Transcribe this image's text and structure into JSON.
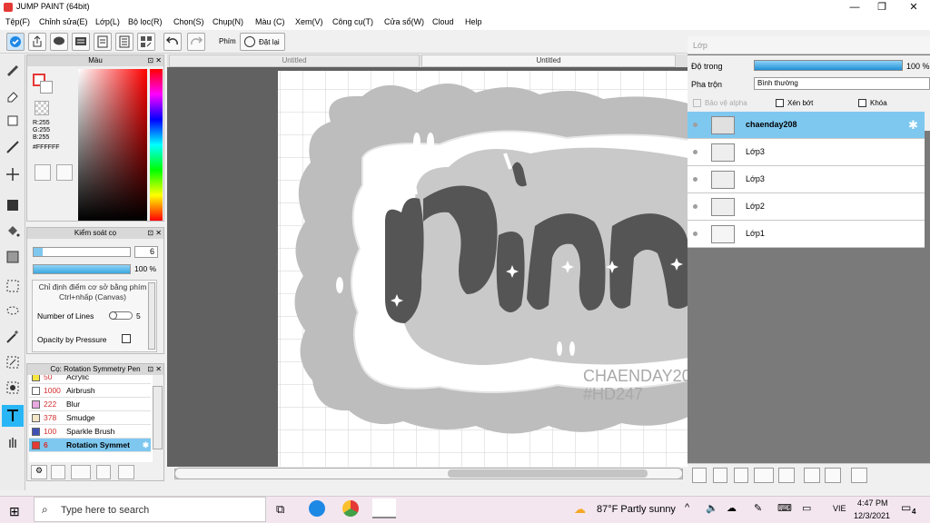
{
  "window": {
    "title": "JUMP PAINT (64bit)"
  },
  "menu": [
    "Tệp(F)",
    "Chỉnh sửa(E)",
    "Lớp(L)",
    "Bộ lọc(R)",
    "Chọn(S)",
    "Chụp(N)",
    "Màu (C)",
    "Xem(V)",
    "Công cụ(T)",
    "Cửa sổ(W)",
    "Cloud",
    "Help"
  ],
  "toolbar": {
    "label_phim": "Phím",
    "reset_label": "Đặt lại"
  },
  "color_panel": {
    "title": "Màu",
    "r": "R:255",
    "g": "G:255",
    "b": "B:255",
    "hex": "#FFFFFF"
  },
  "brush_control": {
    "title": "Kiểm soát cọ",
    "size_value": "6",
    "opacity_value": "100 %",
    "opacity_fraction": 1.0,
    "hint": "Chỉ định điểm cơ sở bằng phím Ctrl+nhấp (Canvas)",
    "lines_label": "Number of Lines",
    "lines_value": "5",
    "pressure_label": "Opacity by Pressure"
  },
  "brush_list": {
    "title": "Cọ: Rotation Symmetry Pen",
    "items": [
      {
        "size": "50",
        "name": "Acrylic",
        "swatch": "#f5e642"
      },
      {
        "size": "1000",
        "name": "Airbrush",
        "swatch": "#ffffff"
      },
      {
        "size": "222",
        "name": "Blur",
        "swatch": "#e8a8e0"
      },
      {
        "size": "378",
        "name": "Smudge",
        "swatch": "#f5e6c8"
      },
      {
        "size": "100",
        "name": "Sparkle Brush",
        "swatch": "#3f51b5"
      },
      {
        "size": "6",
        "name": "Rotation Symmet",
        "swatch": "#e53935",
        "selected": true
      }
    ]
  },
  "tabs": [
    {
      "label": "Untitled"
    },
    {
      "label": "Untitled"
    }
  ],
  "canvas": {
    "watermark_line1": "CHAENDAY20",
    "watermark_line2": "#HD247"
  },
  "layers_panel": {
    "title": "Lớp",
    "opacity_label": "Độ trong",
    "opacity_value": "100 %",
    "opacity_fraction": 1.0,
    "blend_label": "Pha trộn",
    "blend_value": "Bình thường",
    "protect_alpha": "Bảo vệ alpha",
    "clip": "Xén bớt",
    "lock": "Khóa",
    "layers": [
      {
        "name": "chaenday208",
        "selected": true
      },
      {
        "name": "Lớp3"
      },
      {
        "name": "Lớp3"
      },
      {
        "name": "Lớp2"
      },
      {
        "name": "Lớp1"
      }
    ]
  },
  "taskbar": {
    "search_placeholder": "Type here to search",
    "weather": "87°F  Partly sunny",
    "lang": "VIE",
    "time": "4:47 PM",
    "date": "12/3/2021",
    "notification_count": "4"
  },
  "colors": {
    "accent": "#7ec8f0",
    "selected_layer": "#7ec8f0",
    "canvas_bg": "#616161",
    "taskbar": "#f3e6ef"
  }
}
